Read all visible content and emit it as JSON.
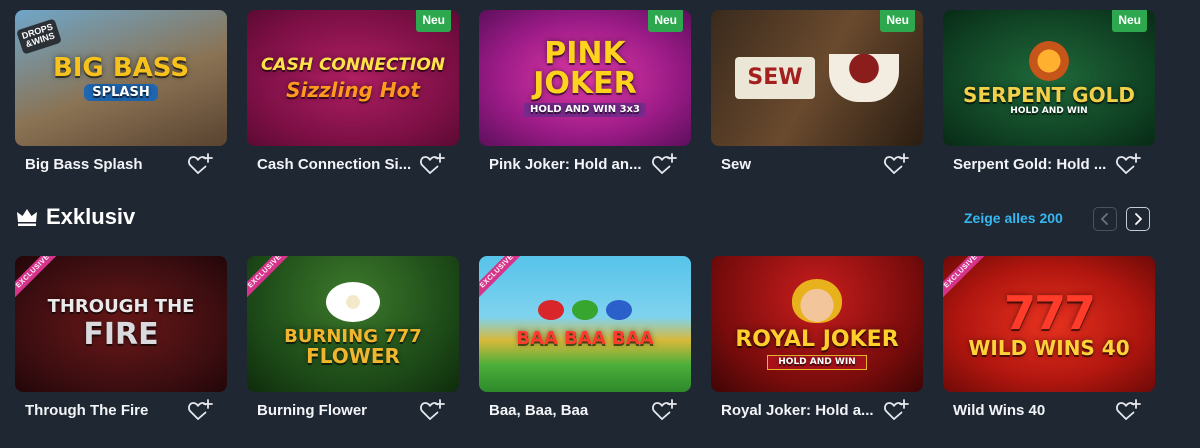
{
  "top_games": [
    {
      "name": "Big Bass Splash",
      "art_line1": "BIG BASS",
      "art_line2": "SPLASH",
      "badge": "",
      "drops": "DROPS\n&WINS"
    },
    {
      "name": "Cash Connection Si...",
      "art_line1": "CASH CONNECTION",
      "art_line2": "Sizzling Hot",
      "badge": "Neu"
    },
    {
      "name": "Pink Joker: Hold an...",
      "art_line1": "PINK JOKER",
      "art_line2": "HOLD AND WIN 3x3",
      "badge": "Neu"
    },
    {
      "name": "Sew",
      "art_line1": "SEW",
      "art_line2": "",
      "badge": "Neu"
    },
    {
      "name": "Serpent Gold: Hold ...",
      "art_line1": "SERPENT GOLD",
      "art_line2": "HOLD AND WIN",
      "badge": "Neu"
    }
  ],
  "section": {
    "title": "Exklusiv",
    "show_all": "Zeige alles 200"
  },
  "exclusive_badge": "EXCLUSIVE",
  "bottom_games": [
    {
      "name": "Through The Fire",
      "art_line1": "THROUGH THE",
      "art_line2": "FIRE"
    },
    {
      "name": "Burning Flower",
      "art_line1": "BURNING 777",
      "art_line2": "FLOWER"
    },
    {
      "name": "Baa, Baa, Baa",
      "art_line1": "BAA BAA BAA",
      "art_line2": ""
    },
    {
      "name": "Royal Joker: Hold a...",
      "art_line1": "ROYAL JOKER",
      "art_line2": "HOLD AND WIN"
    },
    {
      "name": "Wild Wins 40",
      "art_line1": "777",
      "art_line2": "WILD WINS 40"
    }
  ],
  "colors": {
    "background": "#1f2733",
    "accent_link": "#36b7f0",
    "badge_new": "#2ea84f",
    "badge_exclusive": "#d6338a"
  },
  "icons": [
    "heart-plus-icon",
    "crown-icon",
    "chevron-left-icon",
    "chevron-right-icon"
  ]
}
